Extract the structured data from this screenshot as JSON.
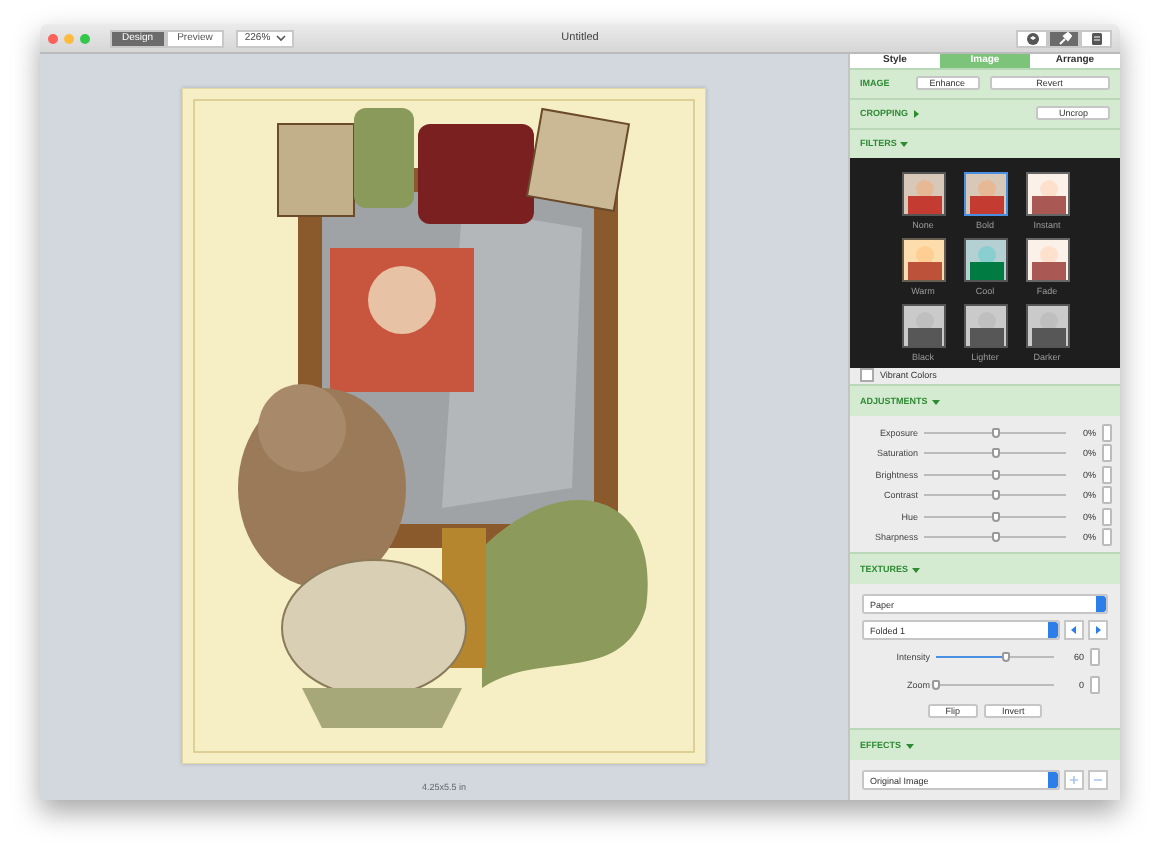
{
  "window": {
    "title": "Untitled"
  },
  "toolbar": {
    "modes": [
      {
        "label": "Design",
        "selected": true
      },
      {
        "label": "Preview",
        "selected": false
      }
    ],
    "zoom": "226%"
  },
  "inspector_buttons": [
    {
      "kind": "shape",
      "selected": false
    },
    {
      "kind": "brush",
      "selected": true
    },
    {
      "kind": "document",
      "selected": false
    }
  ],
  "canvas": {
    "size": "4.25x5.5 in"
  },
  "tabs": [
    {
      "label": "Style",
      "selected": false
    },
    {
      "label": "Image",
      "selected": true
    },
    {
      "label": "Arrange",
      "selected": false
    }
  ],
  "image_row": {
    "label": "IMAGE",
    "buttons": [
      "Enhance",
      "Revert"
    ]
  },
  "cropping": {
    "label": "CROPPING",
    "expanded": false,
    "button": "Uncrop"
  },
  "filters": {
    "label": "FILTERS",
    "expanded": true,
    "items": [
      {
        "label": "None",
        "kind": "color",
        "selected": false
      },
      {
        "label": "Bold",
        "kind": "color",
        "selected": true
      },
      {
        "label": "Instant",
        "kind": "faded",
        "selected": false
      },
      {
        "label": "Warm",
        "kind": "warm",
        "selected": false
      },
      {
        "label": "Cool",
        "kind": "cool",
        "selected": false
      },
      {
        "label": "Fade",
        "kind": "faded",
        "selected": false
      },
      {
        "label": "Black",
        "kind": "mono",
        "selected": false
      },
      {
        "label": "Lighter",
        "kind": "mono",
        "selected": false
      },
      {
        "label": "Darker",
        "kind": "mono",
        "selected": false
      }
    ]
  },
  "vibrant": {
    "label": "Vibrant Colors",
    "checked": false
  },
  "adjustments": {
    "label": "ADJUSTMENTS",
    "expanded": true,
    "items": [
      {
        "name": "Exposure",
        "level": 0.5,
        "reading": "0%"
      },
      {
        "name": "Saturation",
        "level": 0.5,
        "reading": "0%"
      },
      {
        "name": "Brightness",
        "level": 0.5,
        "reading": "0%"
      },
      {
        "name": "Contrast",
        "level": 0.5,
        "reading": "0%"
      },
      {
        "name": "Hue",
        "level": 0.5,
        "reading": "0%"
      },
      {
        "name": "Sharpness",
        "level": 0.5,
        "reading": "0%"
      }
    ]
  },
  "textures": {
    "label": "TEXTURES",
    "expanded": true,
    "pattern": "Paper",
    "variant": "Folded 1",
    "sliders": [
      {
        "name": "Intensity",
        "level": 0.6,
        "reading": "60"
      },
      {
        "name": "Zoom",
        "level": 0,
        "reading": "0"
      }
    ],
    "buttons": [
      "Flip",
      "Invert"
    ]
  },
  "effects": {
    "label": "EFFECTS",
    "expanded": true,
    "selected": "Original Image"
  }
}
